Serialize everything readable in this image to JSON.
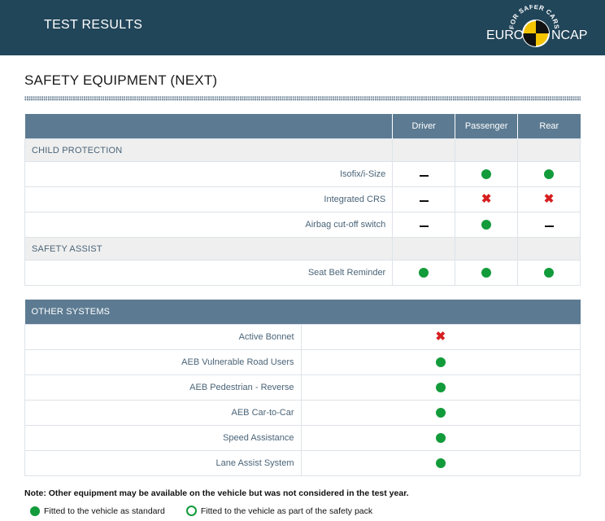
{
  "header": {
    "title": "TEST RESULTS",
    "logo": {
      "left_text": "EURO",
      "right_text": "NCAP",
      "arc_text": "FOR SAFER CARS"
    }
  },
  "page_title": "SAFETY EQUIPMENT (NEXT)",
  "colors": {
    "header_bg": "#214559",
    "table_header_bg": "#5c7b92",
    "fitted_green": "#129b3a",
    "not_fitted_red": "#d61e1e",
    "logo_yellow": "#f5c400"
  },
  "occupant_table": {
    "columns": [
      "Driver",
      "Passenger",
      "Rear"
    ],
    "sections": [
      {
        "title": "CHILD PROTECTION",
        "rows": [
          {
            "label": "Isofix/i-Size",
            "values": [
              "dash",
              "fitted",
              "fitted"
            ]
          },
          {
            "label": "Integrated CRS",
            "values": [
              "dash",
              "not-fitted",
              "not-fitted"
            ]
          },
          {
            "label": "Airbag cut-off switch",
            "values": [
              "dash",
              "fitted",
              "dash"
            ]
          }
        ]
      },
      {
        "title": "SAFETY ASSIST",
        "rows": [
          {
            "label": "Seat Belt Reminder",
            "values": [
              "fitted",
              "fitted",
              "fitted"
            ]
          }
        ]
      }
    ]
  },
  "other_systems": {
    "title": "OTHER SYSTEMS",
    "rows": [
      {
        "label": "Active Bonnet",
        "value": "not-fitted"
      },
      {
        "label": "AEB Vulnerable Road Users",
        "value": "fitted"
      },
      {
        "label": "AEB Pedestrian - Reverse",
        "value": "fitted"
      },
      {
        "label": "AEB Car-to-Car",
        "value": "fitted"
      },
      {
        "label": "Speed Assistance",
        "value": "fitted"
      },
      {
        "label": "Lane Assist System",
        "value": "fitted"
      }
    ]
  },
  "note": "Note: Other equipment may be available on the vehicle but was not considered in the test year.",
  "legend": {
    "standard": "Fitted to the vehicle as standard",
    "safety_pack": "Fitted to the vehicle as part of the safety pack"
  }
}
